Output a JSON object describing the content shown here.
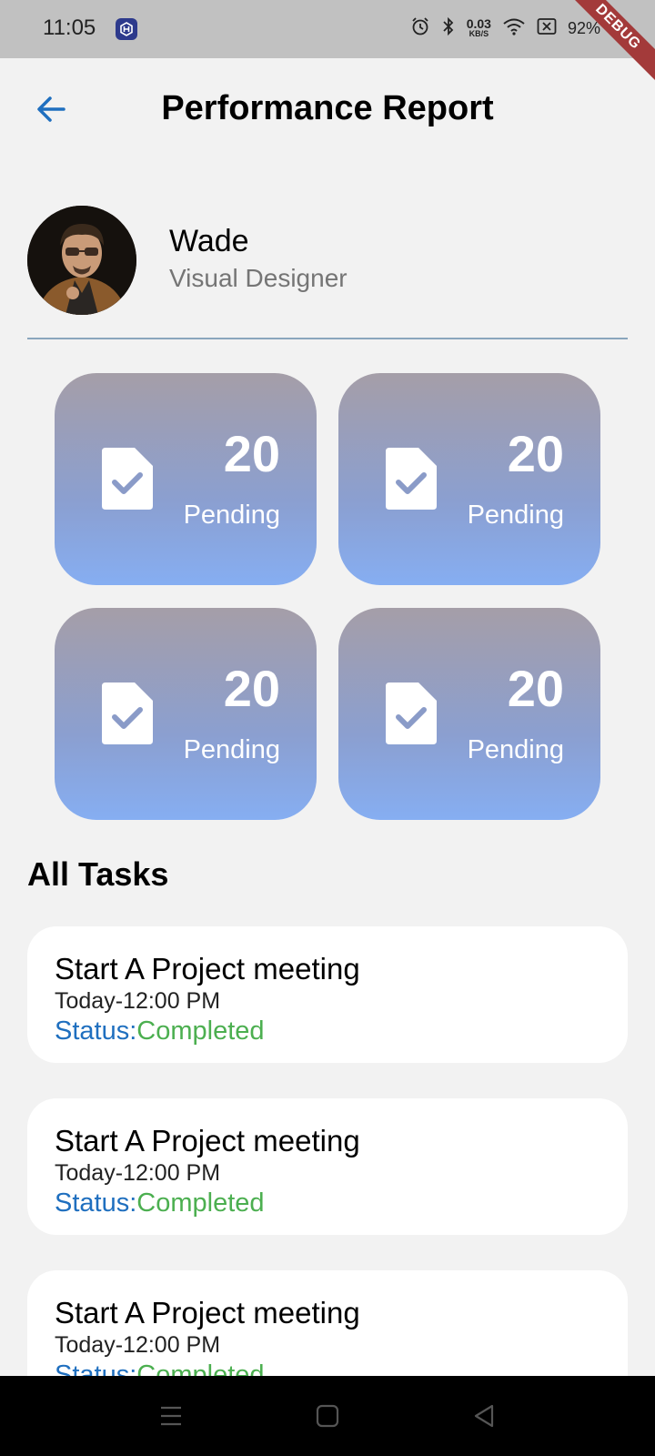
{
  "status_bar": {
    "time": "11:05",
    "speed_value": "0.03",
    "speed_unit": "KB/S",
    "battery": "92%",
    "debug_banner": "DEBUG",
    "icons": [
      "app-icon",
      "alarm-icon",
      "bluetooth-icon",
      "wifi-icon",
      "sim-icon",
      "battery-charging-icon"
    ]
  },
  "header": {
    "title": "Performance Report",
    "back_icon": "arrow-left-icon"
  },
  "profile": {
    "name": "Wade",
    "role": "Visual Designer"
  },
  "stats": [
    {
      "value": "20",
      "label": "Pending",
      "icon": "document-check-icon"
    },
    {
      "value": "20",
      "label": "Pending",
      "icon": "document-check-icon"
    },
    {
      "value": "20",
      "label": "Pending",
      "icon": "document-check-icon"
    },
    {
      "value": "20",
      "label": "Pending",
      "icon": "document-check-icon"
    }
  ],
  "tasks_section": {
    "title": "All Tasks"
  },
  "tasks": [
    {
      "title": "Start A Project meeting",
      "time": "Today-12:00 PM",
      "status_label": "Status:",
      "status_value": "Completed"
    },
    {
      "title": "Start A Project meeting",
      "time": "Today-12:00 PM",
      "status_label": "Status:",
      "status_value": "Completed"
    },
    {
      "title": "Start A Project meeting",
      "time": "Today-12:00 PM",
      "status_label": "Status:",
      "status_value": "Completed"
    }
  ],
  "colors": {
    "accent_blue": "#1f6fbf",
    "status_green": "#4caf50",
    "card_gradient_top": "#a59ea8",
    "card_gradient_bottom": "#86aef2"
  },
  "nav_bar": {
    "icons": [
      "menu-icon",
      "home-square-icon",
      "back-triangle-icon"
    ]
  }
}
